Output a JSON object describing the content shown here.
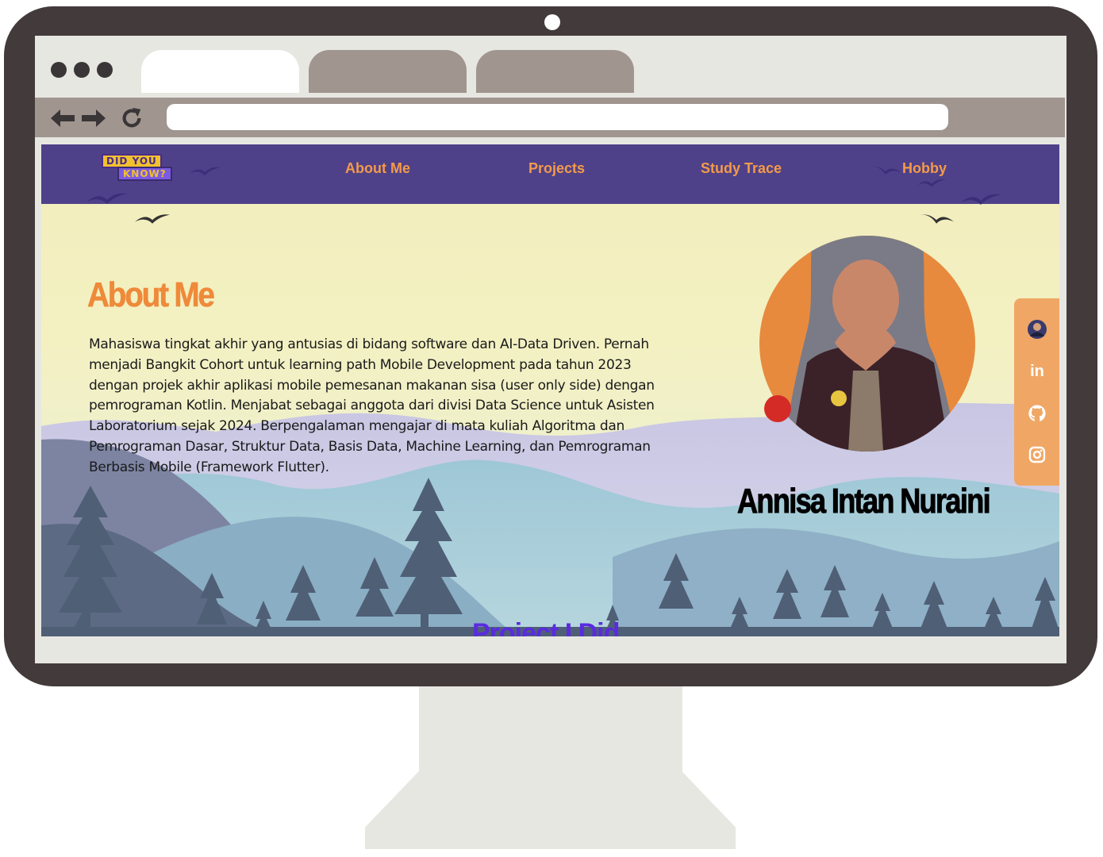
{
  "logo": {
    "line1": "DID YOU",
    "line2": "KNOW?"
  },
  "nav": {
    "about": "About Me",
    "projects": "Projects",
    "study": "Study Trace",
    "hobby": "Hobby"
  },
  "hero": {
    "title": "About Me",
    "description": "Mahasiswa tingkat akhir yang antusias di bidang software dan AI-Data Driven. Pernah menjadi Bangkit Cohort untuk learning path Mobile Development pada tahun 2023 dengan projek akhir aplikasi mobile pemesanan makanan sisa (user only side) dengan pemrograman Kotlin. Menjabat sebagai anggota dari divisi Data Science untuk Asisten Laboratorium sejak 2024. Berpengalaman mengajar di mata kuliah Algoritma dan Pemrograman Dasar, Struktur Data, Basis Data, Machine Learning, dan Pemrograman Berbasis Mobile (Framework Flutter).",
    "name": "Annisa Intan Nuraini"
  },
  "social": {
    "linkedin_glyph": "in",
    "icons": [
      "profile-icon",
      "linkedin-icon",
      "github-icon",
      "instagram-icon"
    ]
  },
  "next_section": {
    "title": "Project I Did"
  },
  "colors": {
    "navbar": "#4f4189",
    "accent": "#ee8a3a",
    "social_panel": "#f0a765",
    "monitor_frame": "#433a3b"
  }
}
